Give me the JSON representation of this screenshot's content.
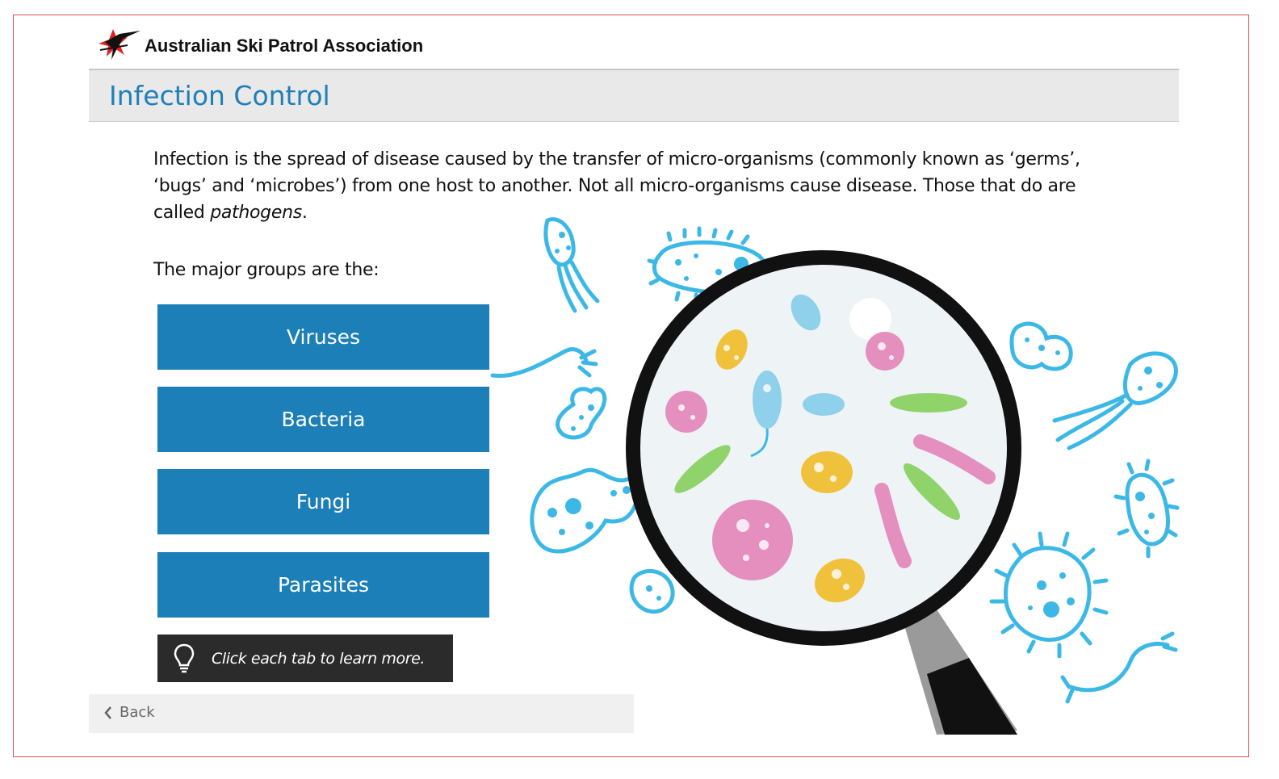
{
  "header": {
    "org_name": "Australian Ski Patrol Association",
    "logo_icon": "skier-star-logo-icon"
  },
  "page": {
    "title": "Infection Control",
    "intro_text": "Infection is the spread of disease caused by the transfer of micro-organisms (commonly known as ‘germs’, ‘bugs’ and ‘microbes’) from one host to another. Not all micro-organisms cause disease. Those that do are called ",
    "intro_em": "pathogens",
    "intro_end": ".",
    "groups_label": "The major groups are the:"
  },
  "tabs": [
    {
      "label": "Viruses"
    },
    {
      "label": "Bacteria"
    },
    {
      "label": "Fungi"
    },
    {
      "label": "Parasites"
    }
  ],
  "hint": {
    "icon": "lightbulb-icon",
    "text": "Click each tab to learn more."
  },
  "nav": {
    "back_label": "Back",
    "back_icon": "chevron-left-icon"
  },
  "colors": {
    "accent": "#1c7fb8",
    "title": "#1f7fb8",
    "hint_bg": "#2b2b2b",
    "frame": "#d9534f"
  }
}
